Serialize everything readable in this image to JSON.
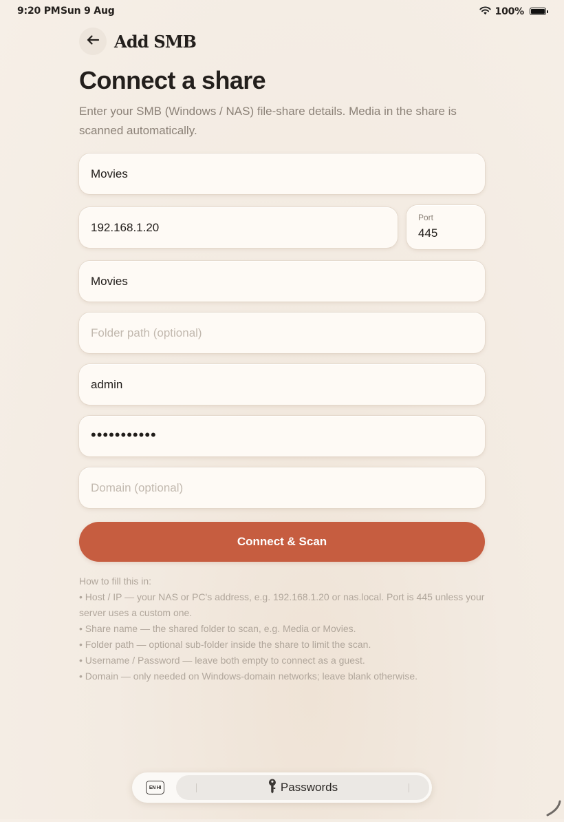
{
  "status_bar": {
    "time": "9:20 PM",
    "date": "Sun 9 Aug",
    "battery_percent": "100%",
    "battery_level": 1.0,
    "icons": [
      "wifi-icon",
      "battery-icon"
    ]
  },
  "header": {
    "back_icon": "arrow-left-icon",
    "title": "Add SMB"
  },
  "page": {
    "title": "Connect a share",
    "subtitle": "Enter your SMB (Windows / NAS) file-share details. Media in the share is scanned automatically."
  },
  "form": {
    "display_name": {
      "value": "Movies"
    },
    "host": {
      "value": "192.168.1.20"
    },
    "port": {
      "label": "Port",
      "value": "445"
    },
    "share_name": {
      "value": "Movies"
    },
    "folder_path": {
      "value": "",
      "placeholder": "Folder path (optional)"
    },
    "username": {
      "value": "admin"
    },
    "password": {
      "value": "•••••••••••"
    },
    "domain": {
      "value": "",
      "placeholder": "Domain (optional)"
    }
  },
  "actions": {
    "connect_label": "Connect & Scan"
  },
  "help": {
    "heading": "How to fill this in:",
    "lines": [
      "• Host / IP — your NAS or PC's address, e.g. 192.168.1.20 or nas.local. Port is 445 unless your server uses a custom one.",
      "• Share name — the shared folder to scan, e.g. Media or Movies.",
      "• Folder path — optional sub-folder inside the share to limit the scan.",
      "• Username / Password — leave both empty to connect as a guest.",
      "• Domain — only needed on Windows-domain networks; leave blank otherwise."
    ]
  },
  "keyboard_bar": {
    "language_label": "EN HI",
    "suggestion_icon": "key-icon",
    "suggestion_label": "Passwords"
  },
  "colors": {
    "accent": "#c65d40",
    "background": "#f4ede5",
    "field_background": "#fefaf5",
    "text_primary": "#231f1c",
    "text_secondary": "#8c8278",
    "placeholder": "#c2b9af"
  }
}
